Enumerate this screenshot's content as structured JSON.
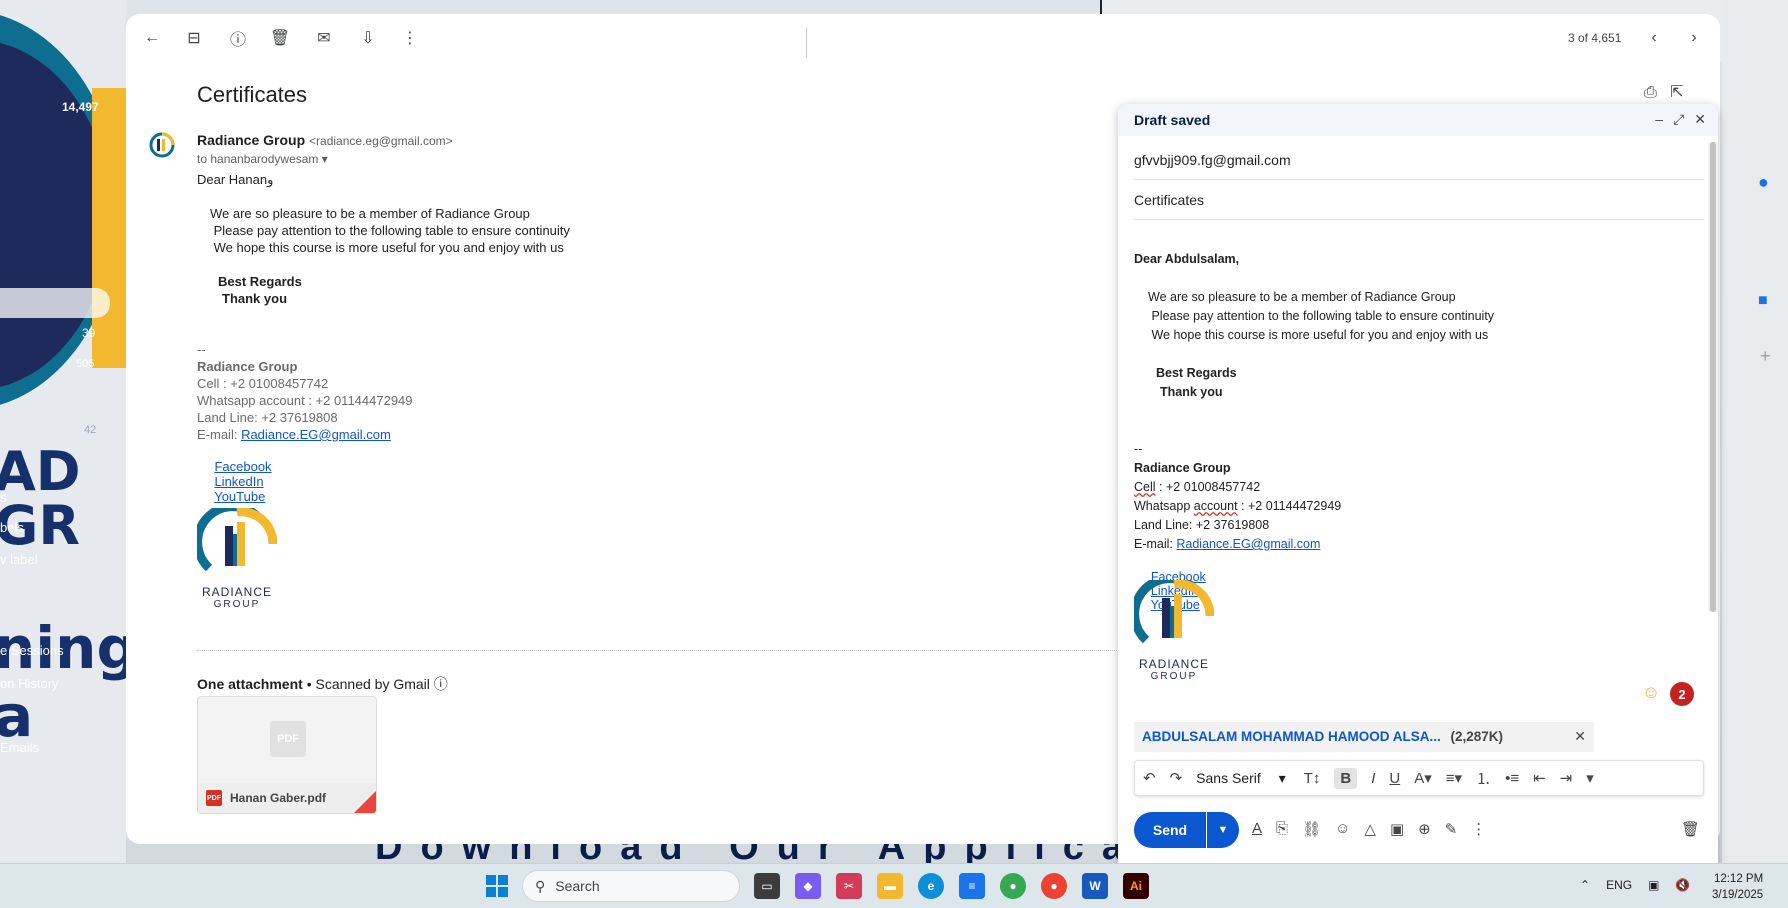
{
  "background": {
    "left_number_top": "14,497",
    "left_number_a": "39",
    "left_number_b": "505",
    "left_number_c": "42",
    "big_text_1": "AD",
    "big_text_2": "GR",
    "big_text_3": "ning a",
    "side_labels": [
      "s",
      "bels",
      "v label",
      "e Sessions",
      "on History",
      "Emails"
    ],
    "bottom_banner": "Download Our Applicati"
  },
  "toolbar": {
    "icons": [
      "back-icon",
      "archive-icon",
      "report-spam-icon",
      "delete-icon",
      "mark-unread-icon",
      "move-to-icon",
      "more-vert-icon"
    ],
    "pager": "3 of 4,651"
  },
  "email": {
    "subject": "Certificates",
    "sender_name": "Radiance Group",
    "sender_email": "<radiance.eg@gmail.com>",
    "to_line": "to hananbarodywesam",
    "greeting": "Dear Hananو",
    "lines": [
      "We are so pleasure to be a member of Radiance Group",
      " Please pay attention to the following table to ensure continuity",
      " We hope this course is more useful for you and enjoy with us"
    ],
    "regards": "Best Regards",
    "thanks": "Thank you",
    "sig_dash": "--",
    "sig_name": "Radiance Group",
    "sig_cell": "Cell : +2 01008457742",
    "sig_whatsapp": "Whatsapp account : +2 01144472949",
    "sig_landline": "Land Line: +2 37619808",
    "sig_email_label": "E-mail: ",
    "sig_email": "Radiance.EG@gmail.com",
    "social": [
      "Facebook",
      "LinkedIn",
      "YouTube"
    ],
    "logo_text_1": "RADIANCE",
    "logo_text_2": "GROUP",
    "attachment_header": "One attachment",
    "attachment_note": "• Scanned by Gmail",
    "attachment_name": "Hanan Gaber.pdf",
    "pdf_label": "PDF"
  },
  "compose": {
    "title": "Draft saved",
    "to": "gfvvbjj909.fg@gmail.com",
    "subject": "Certificates",
    "greeting": "Dear Abdulsalam,",
    "lines": [
      "We are so pleasure to be a member of Radiance Group",
      " Please pay attention to the following table to ensure continuity",
      " We hope this course is more useful for you and enjoy with us"
    ],
    "regards": "Best Regards",
    "thanks": "Thank you",
    "sig_dash": "--",
    "sig_name": "Radiance Group",
    "sig_cell_label": "Cell",
    "sig_cell_rest": " : +2 01008457742",
    "sig_whatsapp_a": "Whatsapp ",
    "sig_whatsapp_b": "account",
    "sig_whatsapp_c": " : +2 01144472949",
    "sig_landline": "Land Line: +2 37619808",
    "sig_email_label": "E-mail: ",
    "sig_email": "Radiance.EG@gmail.com",
    "social": [
      "Facebook",
      "LinkedIn",
      "YouTube"
    ],
    "counter": "2",
    "attachment_name": "ABDULSALAM MOHAMMAD HAMOOD ALSA...",
    "attachment_size": "(2,287K)",
    "font": "Sans Serif",
    "send_label": "Send"
  },
  "taskbar": {
    "search_placeholder": "Search",
    "language": "ENG",
    "time": "12:12 PM",
    "date": "3/19/2025"
  },
  "colors": {
    "accent": "#0b57d0",
    "link": "#1155cc",
    "brand_gold": "#f2b82f",
    "brand_navy": "#1f2a5c"
  }
}
